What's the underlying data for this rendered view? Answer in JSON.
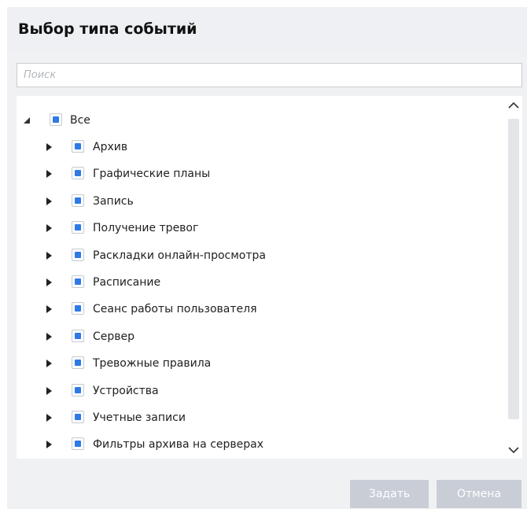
{
  "dialog": {
    "title": "Выбор типа событий",
    "search": {
      "placeholder": "Поиск",
      "value": ""
    },
    "tree": {
      "root": {
        "label": "Все",
        "expanded": true,
        "checked": "partial"
      },
      "items": [
        {
          "label": "Архив"
        },
        {
          "label": "Графические планы"
        },
        {
          "label": "Запись"
        },
        {
          "label": "Получение тревог"
        },
        {
          "label": "Раскладки онлайн-просмотра"
        },
        {
          "label": "Расписание"
        },
        {
          "label": "Сеанс работы пользователя"
        },
        {
          "label": "Сервер"
        },
        {
          "label": "Тревожные правила"
        },
        {
          "label": "Устройства"
        },
        {
          "label": "Учетные записи"
        },
        {
          "label": "Фильтры архива на серверах"
        }
      ]
    },
    "buttons": {
      "apply_label": "Задать",
      "cancel_label": "Отмена"
    },
    "colors": {
      "checkbox_fill": "#2f7ae5",
      "button_bg": "#c8cdd6",
      "header_bg": "#eef0f3"
    }
  }
}
